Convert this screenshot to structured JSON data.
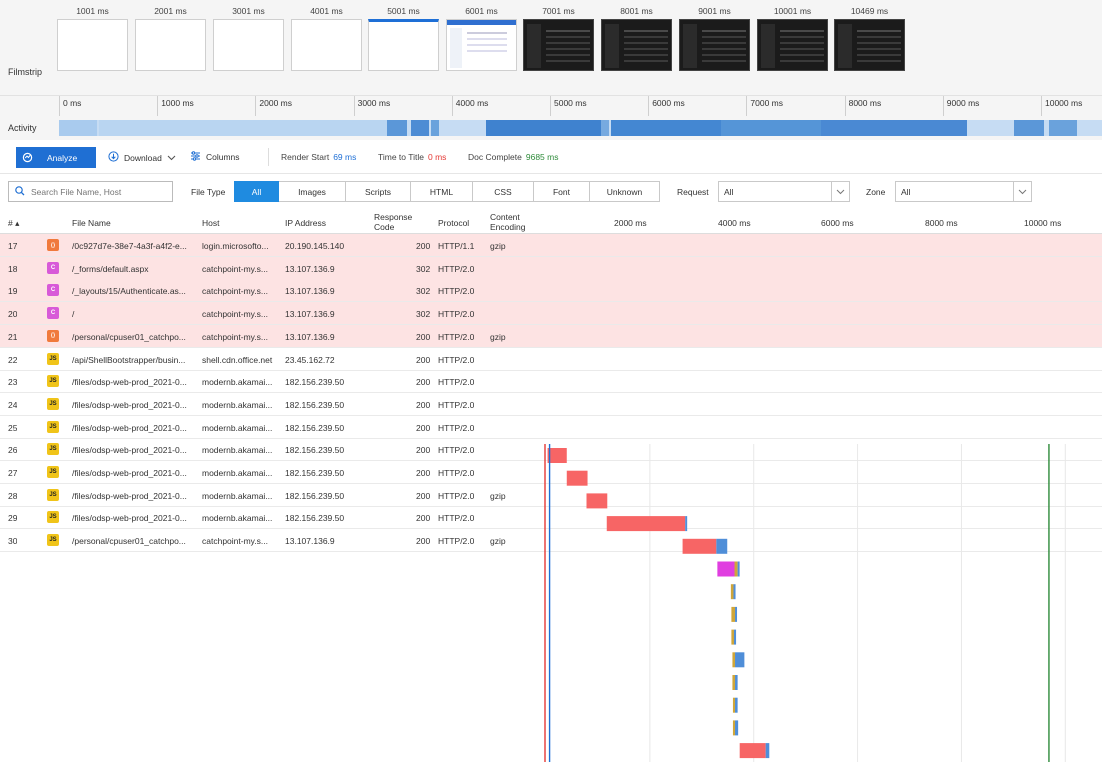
{
  "filmstrip": {
    "label": "Filmstrip",
    "frames": [
      {
        "time": "1001 ms",
        "style": "blank"
      },
      {
        "time": "2001 ms",
        "style": "blank"
      },
      {
        "time": "3001 ms",
        "style": "blank"
      },
      {
        "time": "4001 ms",
        "style": "blank"
      },
      {
        "time": "5001 ms",
        "style": "blank-selected"
      },
      {
        "time": "6001 ms",
        "style": "partial"
      },
      {
        "time": "7001 ms",
        "style": "dark"
      },
      {
        "time": "8001 ms",
        "style": "dark"
      },
      {
        "time": "9001 ms",
        "style": "dark"
      },
      {
        "time": "10001 ms",
        "style": "dark"
      },
      {
        "time": "10469 ms",
        "style": "dark"
      }
    ]
  },
  "timeline": {
    "ticks": [
      "0 ms",
      "1000 ms",
      "2000 ms",
      "3000 ms",
      "4000 ms",
      "5000 ms",
      "6000 ms",
      "7000 ms",
      "8000 ms",
      "9000 ms",
      "10000 ms"
    ],
    "activity_label": "Activity"
  },
  "toolbar": {
    "analyze": "Analyze",
    "download": "Download",
    "columns": "Columns",
    "render_start_label": "Render Start",
    "render_start_value": "69 ms",
    "time_to_title_label": "Time to Title",
    "time_to_title_value": "0 ms",
    "doc_complete_label": "Doc Complete",
    "doc_complete_value": "9685 ms",
    "colors": {
      "render": "#1e6fd6",
      "title": "#e53935",
      "doc": "#2e8b3a"
    }
  },
  "filters": {
    "search_placeholder": "Search File Name, Host",
    "file_type_label": "File Type",
    "file_types": [
      "All",
      "Images",
      "Scripts",
      "HTML",
      "CSS",
      "Font",
      "Unknown"
    ],
    "active_file_type": "All",
    "request_label": "Request",
    "request_value": "All",
    "zone_label": "Zone",
    "zone_value": "All"
  },
  "table": {
    "headers": {
      "num": "# ▴",
      "file": "File Name",
      "host": "Host",
      "ip": "IP Address",
      "code1": "Response",
      "code2": "Code",
      "protocol": "Protocol",
      "enc1": "Content",
      "enc2": "Encoding",
      "w2000": "2000 ms",
      "w4000": "4000 ms",
      "w6000": "6000 ms",
      "w8000": "8000 ms",
      "w10000": "10000 ms"
    },
    "rows": [
      {
        "num": "17",
        "type": "html",
        "file": "/0c927d7e-38e7-4a3f-a4f2-e...",
        "host": "login.microsofto...",
        "ip": "20.190.145.140",
        "code": "200",
        "protocol": "HTTP/1.1",
        "encoding": "gzip",
        "error": true
      },
      {
        "num": "18",
        "type": "css",
        "file": "/_forms/default.aspx",
        "host": "catchpoint-my.s...",
        "ip": "13.107.136.9",
        "code": "302",
        "protocol": "HTTP/2.0",
        "encoding": "",
        "error": true
      },
      {
        "num": "19",
        "type": "css",
        "file": "/_layouts/15/Authenticate.as...",
        "host": "catchpoint-my.s...",
        "ip": "13.107.136.9",
        "code": "302",
        "protocol": "HTTP/2.0",
        "encoding": "",
        "error": true
      },
      {
        "num": "20",
        "type": "css",
        "file": "/",
        "host": "catchpoint-my.s...",
        "ip": "13.107.136.9",
        "code": "302",
        "protocol": "HTTP/2.0",
        "encoding": "",
        "error": true
      },
      {
        "num": "21",
        "type": "html",
        "file": "/personal/cpuser01_catchpo...",
        "host": "catchpoint-my.s...",
        "ip": "13.107.136.9",
        "code": "200",
        "protocol": "HTTP/2.0",
        "encoding": "gzip",
        "error": true
      },
      {
        "num": "22",
        "type": "js",
        "file": "/api/ShellBootstrapper/busin...",
        "host": "shell.cdn.office.net",
        "ip": "23.45.162.72",
        "code": "200",
        "protocol": "HTTP/2.0",
        "encoding": "",
        "error": false
      },
      {
        "num": "23",
        "type": "js",
        "file": "/files/odsp-web-prod_2021-0...",
        "host": "modernb.akamai...",
        "ip": "182.156.239.50",
        "code": "200",
        "protocol": "HTTP/2.0",
        "encoding": "",
        "error": false
      },
      {
        "num": "24",
        "type": "js",
        "file": "/files/odsp-web-prod_2021-0...",
        "host": "modernb.akamai...",
        "ip": "182.156.239.50",
        "code": "200",
        "protocol": "HTTP/2.0",
        "encoding": "",
        "error": false
      },
      {
        "num": "25",
        "type": "js",
        "file": "/files/odsp-web-prod_2021-0...",
        "host": "modernb.akamai...",
        "ip": "182.156.239.50",
        "code": "200",
        "protocol": "HTTP/2.0",
        "encoding": "",
        "error": false
      },
      {
        "num": "26",
        "type": "js",
        "file": "/files/odsp-web-prod_2021-0...",
        "host": "modernb.akamai...",
        "ip": "182.156.239.50",
        "code": "200",
        "protocol": "HTTP/2.0",
        "encoding": "",
        "error": false
      },
      {
        "num": "27",
        "type": "js",
        "file": "/files/odsp-web-prod_2021-0...",
        "host": "modernb.akamai...",
        "ip": "182.156.239.50",
        "code": "200",
        "protocol": "HTTP/2.0",
        "encoding": "",
        "error": false
      },
      {
        "num": "28",
        "type": "js",
        "file": "/files/odsp-web-prod_2021-0...",
        "host": "modernb.akamai...",
        "ip": "182.156.239.50",
        "code": "200",
        "protocol": "HTTP/2.0",
        "encoding": "gzip",
        "error": false
      },
      {
        "num": "29",
        "type": "js",
        "file": "/files/odsp-web-prod_2021-0...",
        "host": "modernb.akamai...",
        "ip": "182.156.239.50",
        "code": "200",
        "protocol": "HTTP/2.0",
        "encoding": "",
        "error": false
      },
      {
        "num": "30",
        "type": "js",
        "file": "/personal/cpuser01_catchpo...",
        "host": "catchpoint-my.s...",
        "ip": "13.107.136.9",
        "code": "200",
        "protocol": "HTTP/2.0",
        "encoding": "gzip",
        "error": false
      }
    ]
  },
  "waterfall": {
    "max_ms": 10469,
    "render_start_ms": 69,
    "doc_complete_ms": 9685,
    "colors": {
      "error_bar": "#f76565",
      "js_exec": "#e03ee0",
      "content": "#4f8ed8",
      "wait": "#cfa63a"
    },
    "requests": [
      {
        "start": 30,
        "segments": [
          {
            "ms": 370,
            "type": "error_bar"
          }
        ]
      },
      {
        "start": 400,
        "segments": [
          {
            "ms": 400,
            "type": "error_bar"
          }
        ]
      },
      {
        "start": 780,
        "segments": [
          {
            "ms": 400,
            "type": "error_bar"
          }
        ]
      },
      {
        "start": 1170,
        "segments": [
          {
            "ms": 1510,
            "type": "error_bar"
          },
          {
            "ms": 30,
            "type": "content"
          }
        ]
      },
      {
        "start": 2630,
        "segments": [
          {
            "ms": 650,
            "type": "error_bar"
          },
          {
            "ms": 210,
            "type": "content"
          }
        ]
      },
      {
        "start": 3300,
        "segments": [
          {
            "ms": 330,
            "type": "js_exec"
          },
          {
            "ms": 60,
            "type": "wait"
          },
          {
            "ms": 30,
            "type": "content"
          }
        ]
      },
      {
        "start": 3560,
        "segments": [
          {
            "ms": 50,
            "type": "wait"
          },
          {
            "ms": 40,
            "type": "content"
          }
        ]
      },
      {
        "start": 3570,
        "segments": [
          {
            "ms": 70,
            "type": "wait"
          },
          {
            "ms": 20,
            "type": "content"
          }
        ]
      },
      {
        "start": 3570,
        "segments": [
          {
            "ms": 50,
            "type": "wait"
          },
          {
            "ms": 40,
            "type": "content"
          }
        ]
      },
      {
        "start": 3590,
        "segments": [
          {
            "ms": 50,
            "type": "wait"
          },
          {
            "ms": 180,
            "type": "content"
          }
        ]
      },
      {
        "start": 3590,
        "segments": [
          {
            "ms": 50,
            "type": "wait"
          },
          {
            "ms": 50,
            "type": "content"
          }
        ]
      },
      {
        "start": 3600,
        "segments": [
          {
            "ms": 40,
            "type": "wait"
          },
          {
            "ms": 50,
            "type": "content"
          }
        ]
      },
      {
        "start": 3600,
        "segments": [
          {
            "ms": 40,
            "type": "wait"
          },
          {
            "ms": 60,
            "type": "content"
          }
        ]
      },
      {
        "start": 3730,
        "segments": [
          {
            "ms": 500,
            "type": "error_bar"
          },
          {
            "ms": 70,
            "type": "content"
          }
        ]
      }
    ]
  }
}
